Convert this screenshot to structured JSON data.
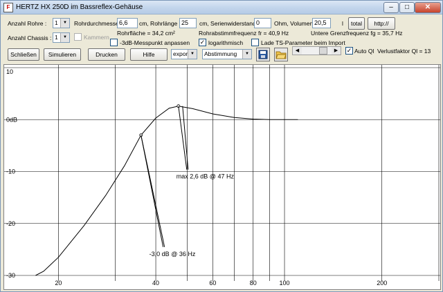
{
  "window": {
    "title": "HERTZ HX 250D im Bassreflex-Gehäuse",
    "icon_letter": "F",
    "minimize": "–",
    "maximize": "□",
    "close": "✕"
  },
  "params": {
    "anzahl_rohre_label": "Anzahl Rohre :",
    "anzahl_rohre_value": "1",
    "rohrdurchmesser_label": "Rohrdurchmesser",
    "rohrdurchmesser_value": "6,6",
    "rohrlaenge_label": "cm, Rohrlänge",
    "rohrlaenge_value": "25",
    "serienwiderstand_label": "cm, Serienwiderstand",
    "serienwiderstand_value": "0",
    "volumen_label": "Ohm, Volumen",
    "volumen_value": "20,5",
    "volumen_unit": "l",
    "total_button": "total",
    "http_button": "http://",
    "anzahl_chassis_label": "Anzahl Chassis :",
    "anzahl_chassis_value": "1",
    "kammern_label": "Kammern",
    "rohrflaeche": "Rohrfläche = 34,2 cm²",
    "abstimmfrequenz": "Rohrabstimmfrequenz fr = 40,9 Hz",
    "grenzfrequenz": "Untere Grenzfrequenz fg = 35,7 Hz",
    "messpunkt_label": "-3dB-Messpunkt anpassen",
    "logarithmisch_label": "logarithmisch",
    "ts_label": "Lade TS-Parameter beim Import",
    "auto_ql_label": "Auto Ql",
    "verlustfaktor": "Verlustfaktor Ql = 13"
  },
  "toolbar": {
    "schliessen": "Schließen",
    "simulieren": "Simulieren",
    "drucken": "Drucken",
    "hilfe": "Hilfe",
    "export_value": "export",
    "abstimmung_value": "Abstimmung"
  },
  "chart_data": {
    "type": "line",
    "x_scale": "log",
    "xlim": [
      15,
      300
    ],
    "ylim": [
      -30,
      10
    ],
    "y_ticks": [
      10,
      0,
      -10,
      -20,
      -30
    ],
    "y_tick_labels": [
      "10",
      "0dB",
      "-10",
      "-20",
      "-30"
    ],
    "x_ticks": [
      20,
      40,
      60,
      80,
      100,
      200
    ],
    "x_gridlines": [
      20,
      30,
      40,
      50,
      60,
      70,
      80,
      90,
      100,
      200,
      300
    ],
    "series": [
      {
        "x": [
          17,
          18,
          20,
          24,
          28,
          32,
          36,
          40,
          44,
          47,
          52,
          60,
          70,
          80,
          90,
          100,
          110
        ],
        "y": [
          -30,
          -29.2,
          -26.5,
          -20.4,
          -14.6,
          -8.9,
          -3.0,
          0.3,
          2.2,
          2.6,
          2.1,
          1.1,
          0.4,
          0.1,
          0.0,
          0.0,
          0.0
        ]
      }
    ],
    "annotations": [
      {
        "text": "max 2,6 dB @ 47 Hz",
        "x": 47,
        "y": 2.6
      },
      {
        "text": "-3,0 dB @  36 Hz",
        "x": 36,
        "y": -3.0
      }
    ]
  }
}
